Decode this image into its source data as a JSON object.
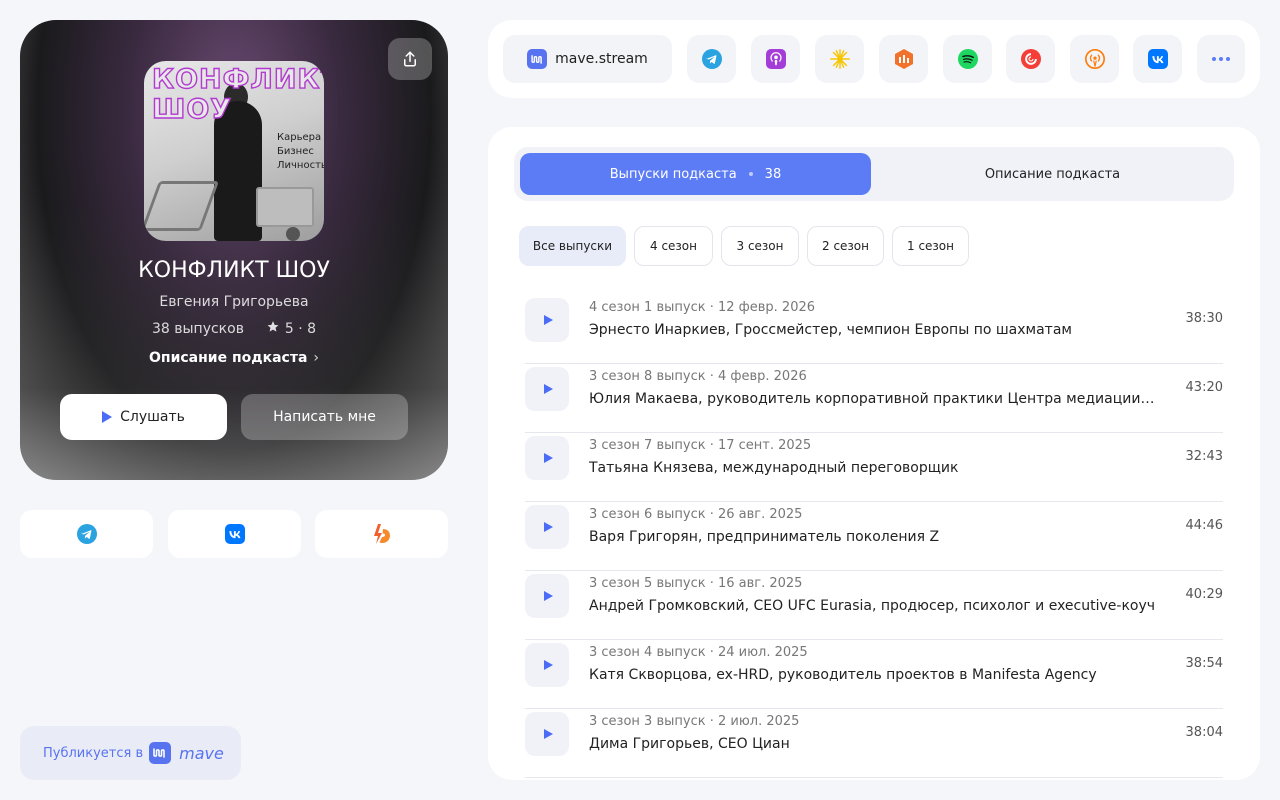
{
  "podcast": {
    "cover_title_line1": "КОНФЛИКТ",
    "cover_title_line2": "ШОУ",
    "cover_tags": [
      "Карьера",
      "Бизнес",
      "Личность"
    ],
    "title": "КОНФЛИКТ ШОУ",
    "author": "Евгения Григорьева",
    "episodes_count": "38 выпусков",
    "rating": "5 · 8",
    "description_link": "Описание подкаста",
    "listen_label": "Слушать",
    "write_label": "Написать мне"
  },
  "published": {
    "label": "Публикуется в",
    "brand": "mave"
  },
  "platforms": {
    "main_label": "mave.stream",
    "icons": [
      "telegram-icon",
      "apple-podcasts-icon",
      "yandex-music-icon",
      "soundstream-icon",
      "spotify-icon",
      "pocket-casts-icon",
      "overcast-icon",
      "vk-icon",
      "more-icon"
    ]
  },
  "tabs": {
    "episodes_label": "Выпуски подкаста",
    "episodes_count": "38",
    "description_label": "Описание подкаста"
  },
  "seasons": [
    "Все выпуски",
    "4 сезон",
    "3 сезон",
    "2 сезон",
    "1 сезон"
  ],
  "episodes": [
    {
      "meta": "4 сезон 1 выпуск · 12 февр. 2026",
      "title": "Эрнесто Инаркиев, Гроссмейстер, чемпион Европы по шахматам",
      "duration": "38:30"
    },
    {
      "meta": "3 сезон 8 выпуск · 4 февр. 2026",
      "title": "Юлия Макаева, руководитель корпоративной практики Центра медиации при Торгово-промышленной палате",
      "duration": "43:20"
    },
    {
      "meta": "3 сезон 7 выпуск · 17 сент. 2025",
      "title": "Татьяна Князева, международный переговорщик",
      "duration": "32:43"
    },
    {
      "meta": "3 сезон 6 выпуск · 26 авг. 2025",
      "title": "Варя Григорян, предприниматель поколения Z",
      "duration": "44:46"
    },
    {
      "meta": "3 сезон 5 выпуск · 16 авг. 2025",
      "title": "Андрей Громковский, CEO UFC Eurasia, продюсер, психолог и executive-коуч",
      "duration": "40:29"
    },
    {
      "meta": "3 сезон 4 выпуск · 24 июл. 2025",
      "title": "Катя Скворцова, ex-HRD, руководитель проектов в Manifesta Agency",
      "duration": "38:54"
    },
    {
      "meta": "3 сезон 3 выпуск · 2 июл. 2025",
      "title": "Дима Григорьев, CEO Циан",
      "duration": "38:04"
    }
  ],
  "colors": {
    "accent": "#5c7cf5",
    "telegram": "#2aa3e0",
    "vk": "#0077ff",
    "spotify": "#1ed760",
    "boosty": "#f15f2c"
  }
}
